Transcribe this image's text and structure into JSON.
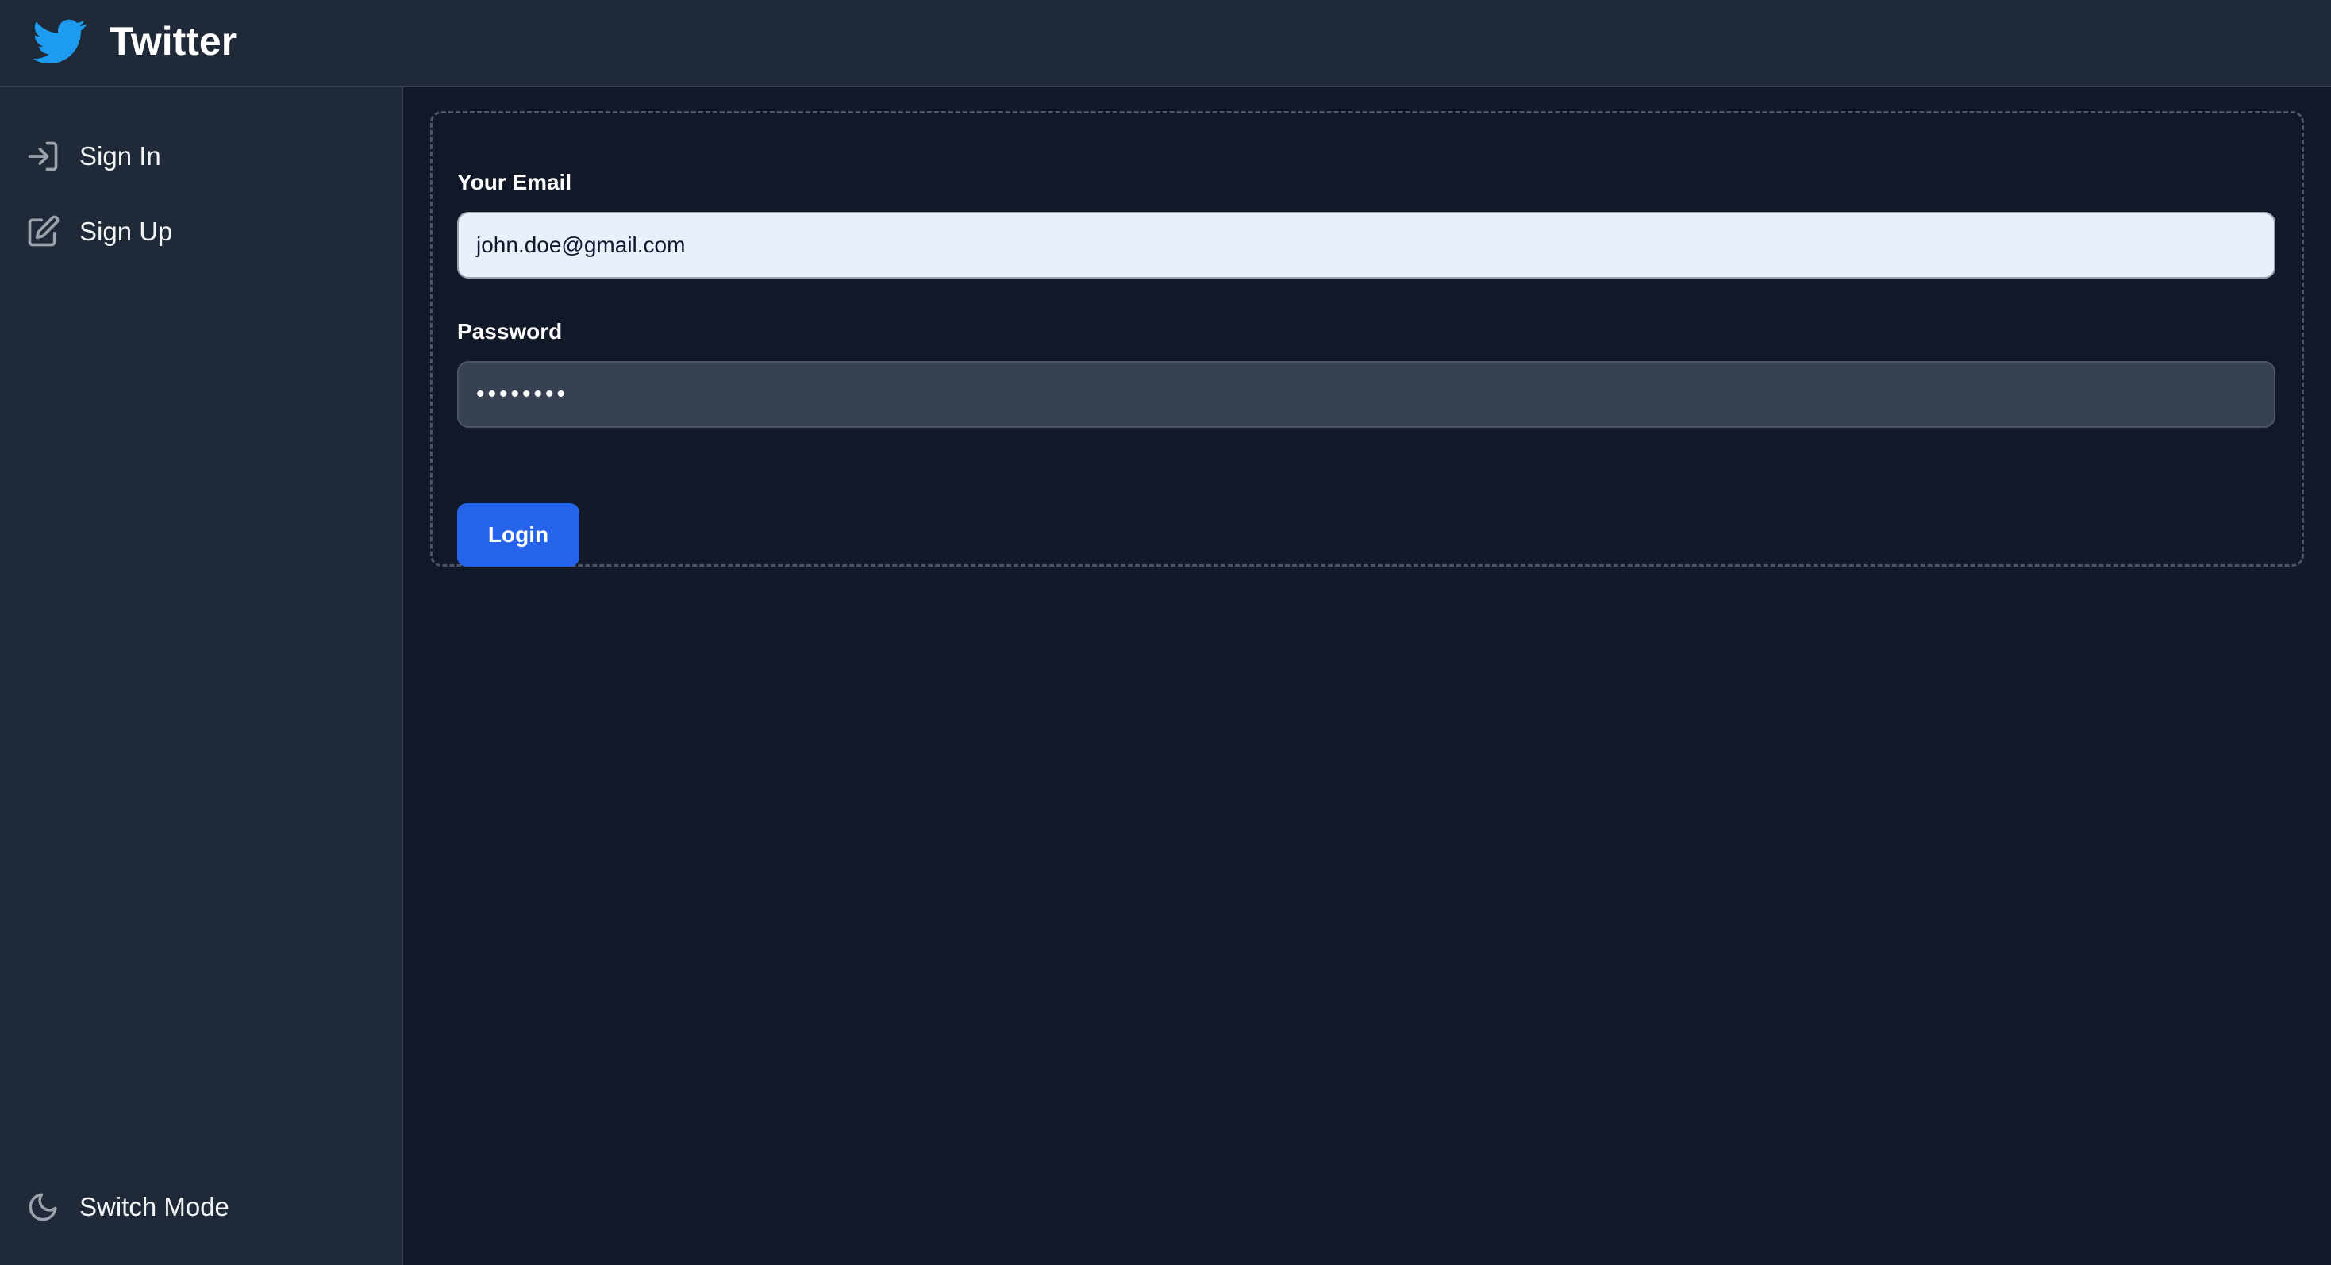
{
  "header": {
    "title": "Twitter",
    "logo_icon": "twitter-bird-icon",
    "brand_color": "#1d9bf0"
  },
  "sidebar": {
    "items": [
      {
        "label": "Sign In",
        "icon": "sign-in-icon"
      },
      {
        "label": "Sign Up",
        "icon": "edit-signup-icon"
      }
    ],
    "footer": {
      "label": "Switch Mode",
      "icon": "moon-icon"
    }
  },
  "login_form": {
    "email_label": "Your Email",
    "email_value": "john.doe@gmail.com",
    "password_label": "Password",
    "password_value": "••••••••",
    "submit_label": "Login",
    "submit_color": "#2563eb"
  }
}
